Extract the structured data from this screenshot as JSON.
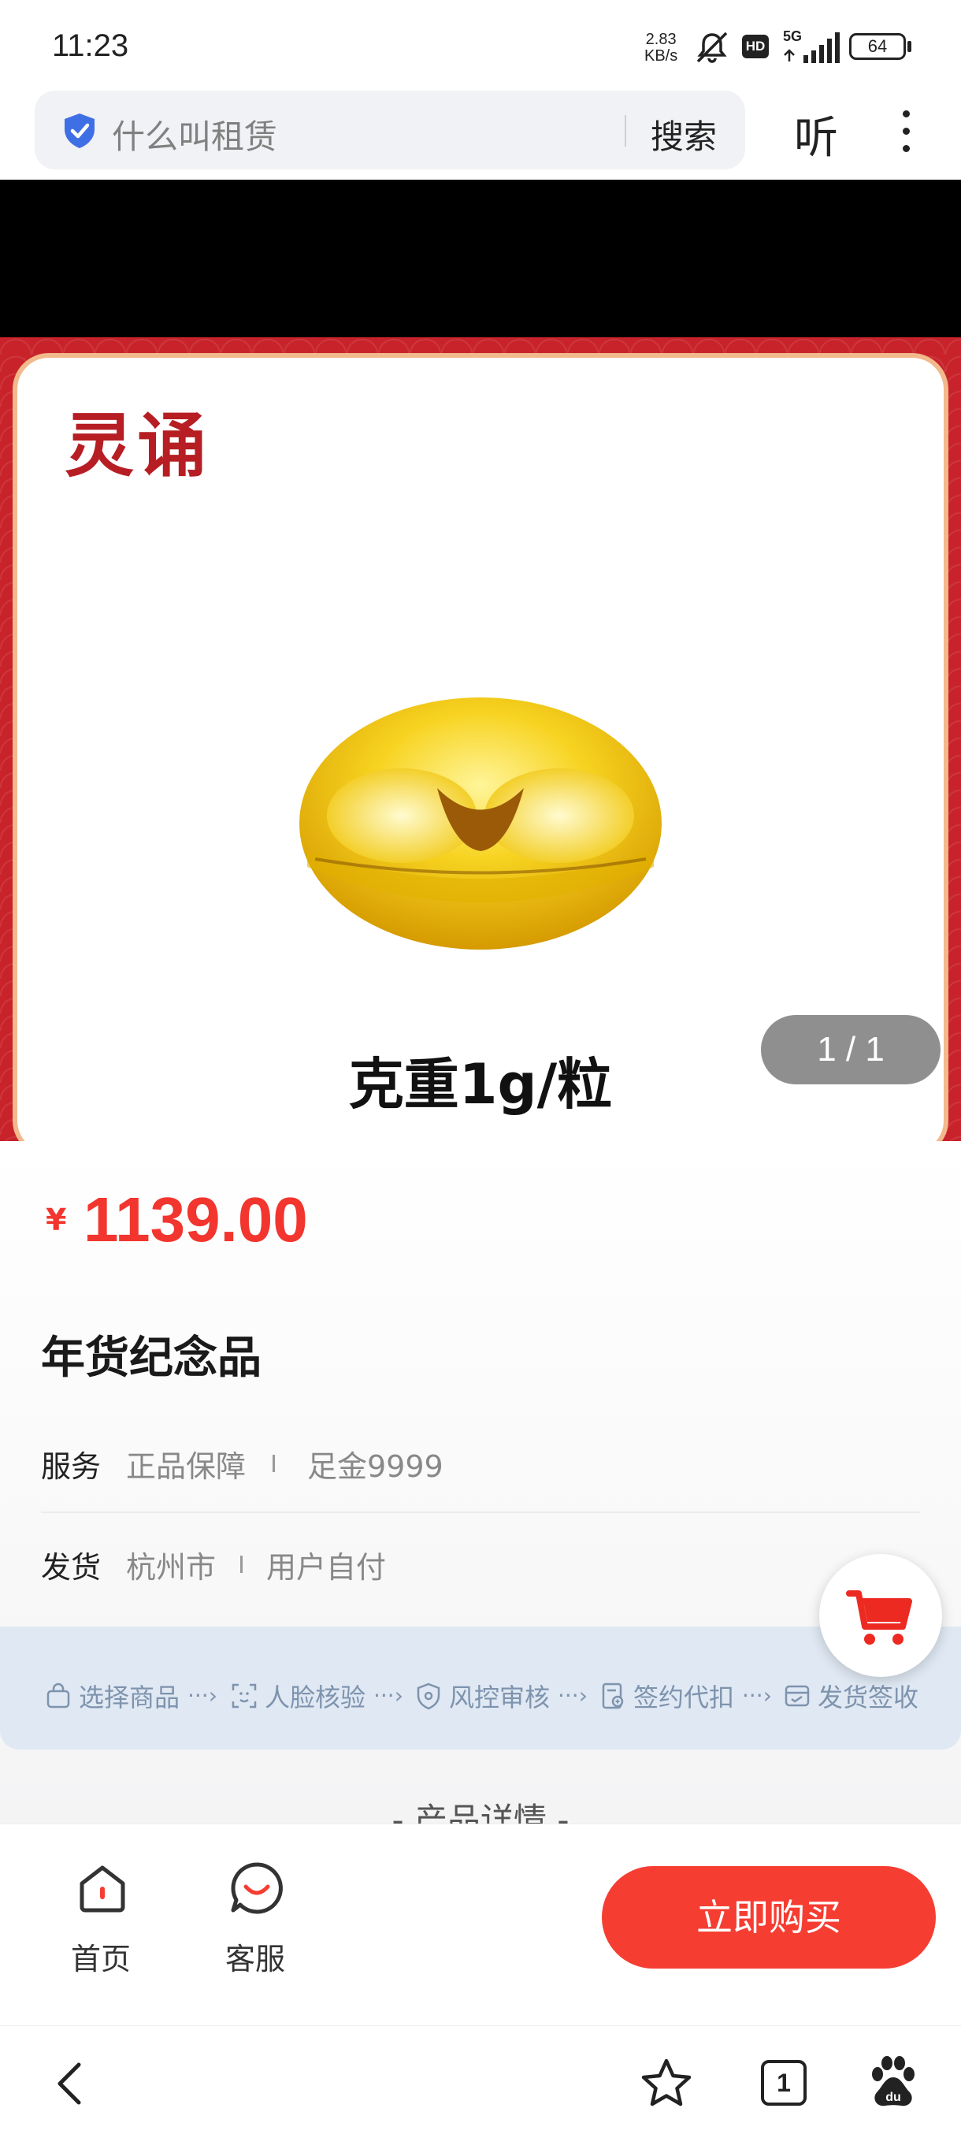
{
  "status_bar": {
    "time": "11:23",
    "net_speed_value": "2.83",
    "net_speed_unit": "KB/s",
    "hd_label": "HD",
    "network_label": "5G",
    "battery": "64"
  },
  "browser": {
    "search_query": "什么叫租赁",
    "search_button": "搜索",
    "listen_button": "听"
  },
  "product_image": {
    "brand": "灵诵",
    "caption": "克重1g/粒",
    "counter": "1 / 1"
  },
  "product": {
    "currency_symbol": "¥",
    "price": "1139.00",
    "title": "年货纪念品",
    "service_label": "服务",
    "service_tags": [
      "正品保障",
      "足金9999"
    ],
    "shipping_label": "发货",
    "shipping_city": "杭州市",
    "shipping_fee": "用户自付"
  },
  "process_steps": [
    "选择商品",
    "人脸核验",
    "风控审核",
    "签约代扣",
    "发货签收"
  ],
  "detail_heading": "- 产品详情 -",
  "bottom_nav": {
    "home_label": "首页",
    "service_label": "客服",
    "buy_label": "立即购买"
  },
  "system_nav": {
    "tabs_count": "1"
  },
  "colors": {
    "accent_red": "#f63d32",
    "price_red": "#f2352e",
    "frame_red": "#c8232a",
    "process_bg": "#dfe8f3"
  }
}
